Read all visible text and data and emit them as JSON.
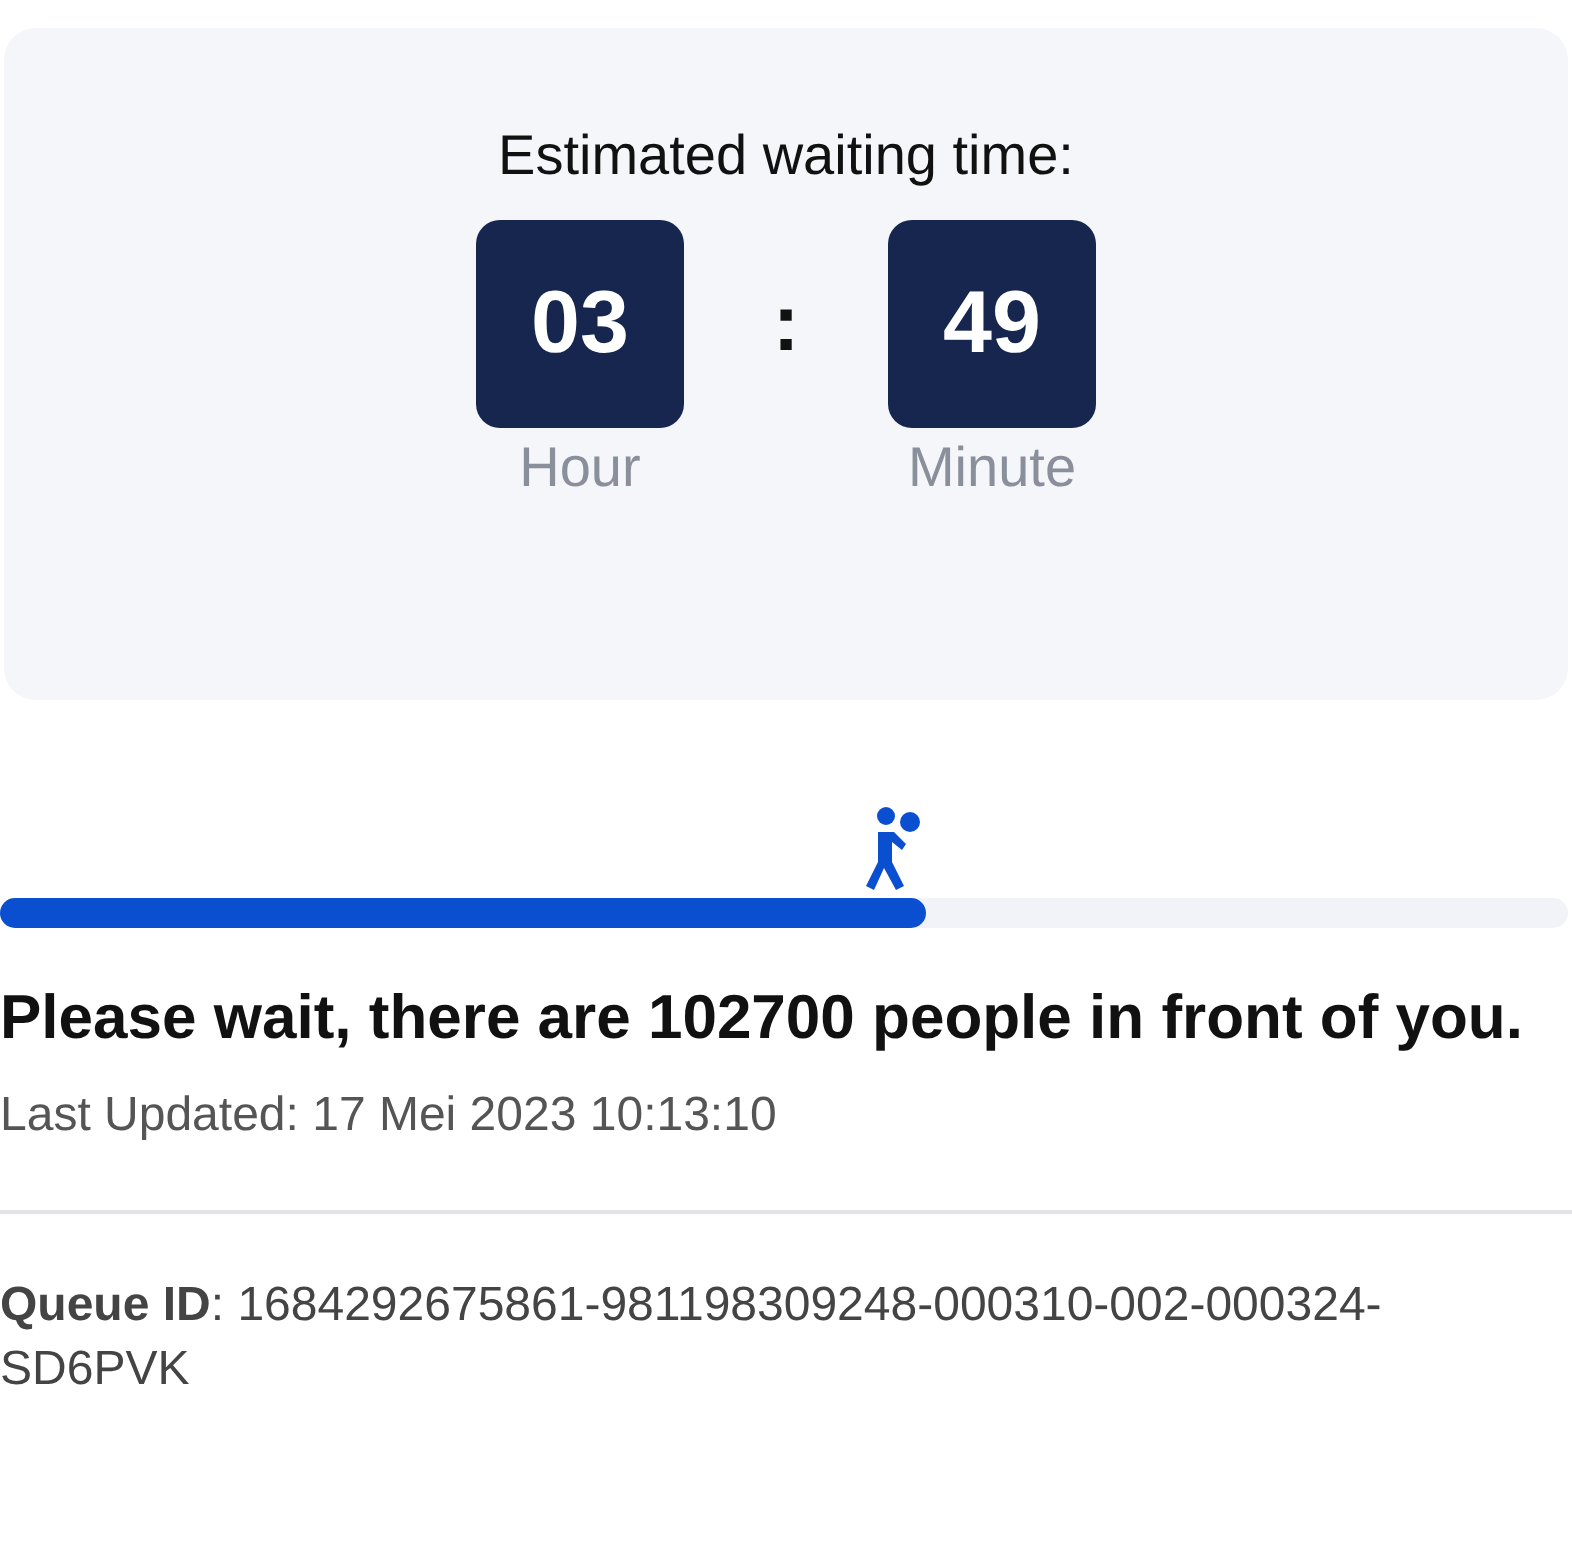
{
  "waiting": {
    "title": "Estimated waiting time:",
    "units": [
      {
        "value": "03",
        "label": "Hour"
      },
      {
        "value": "49",
        "label": "Minute"
      }
    ],
    "separator": ":"
  },
  "progress": {
    "level": 0.59
  },
  "message": "Please wait, there are 102700 people in front of you.",
  "last_updated": "Last Updated: 17 Mei 2023 10:13:10",
  "queue_id": "**Queue ID**: 1684292675861-981198309248-000310-002-000324-SD6PVK"
}
